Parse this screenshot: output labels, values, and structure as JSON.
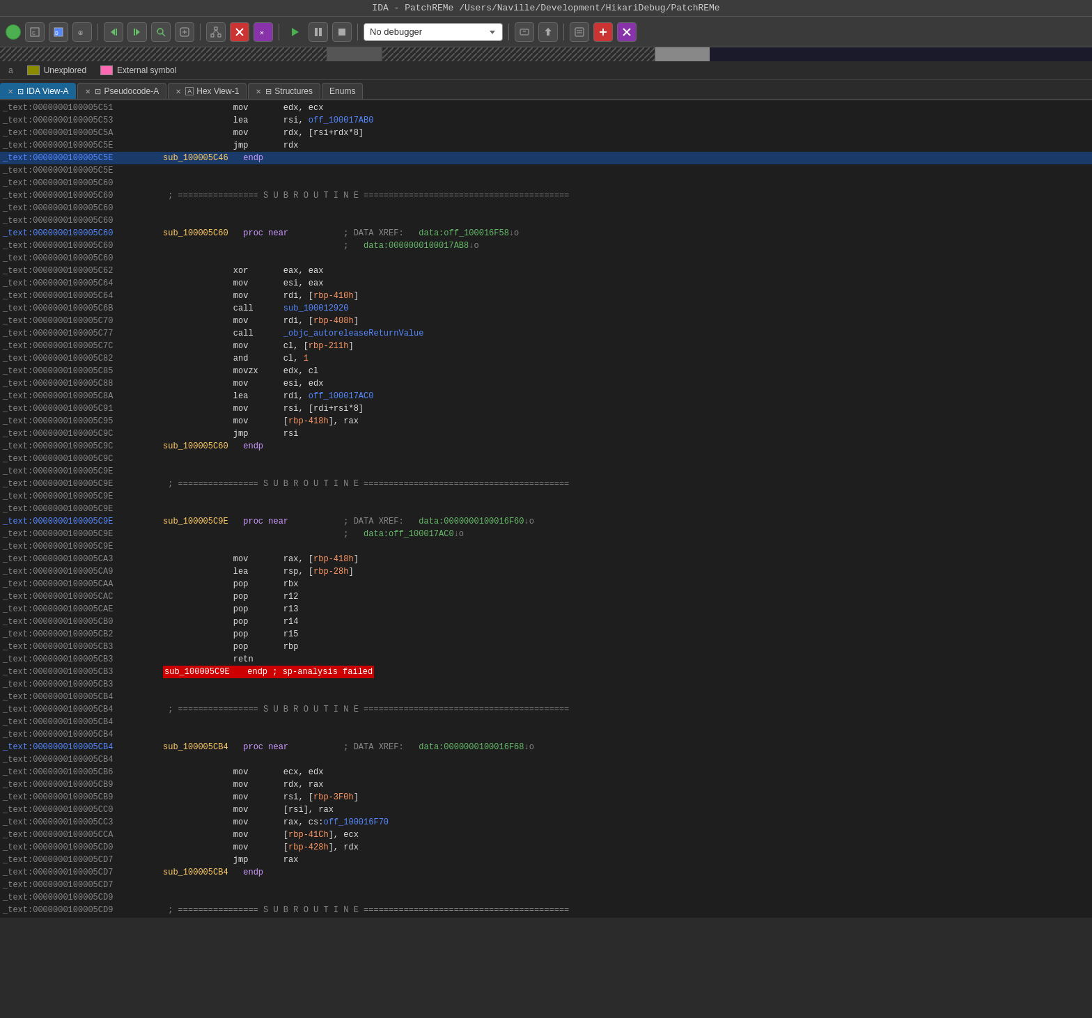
{
  "titleBar": {
    "text": "IDA - PatchREMe /Users/Naville/Development/HikariDebug/PatchREMe"
  },
  "toolbar": {
    "debuggerLabel": "No debugger"
  },
  "legend": {
    "items": [
      {
        "label": "Unexplored",
        "color": "#8B8B00"
      },
      {
        "label": "External symbol",
        "color": "#ff69b4"
      }
    ]
  },
  "tabs": [
    {
      "id": "ida-view",
      "label": "IDA View-A",
      "active": true,
      "closeable": true
    },
    {
      "id": "pseudocode",
      "label": "Pseudocode-A",
      "active": false,
      "closeable": true
    },
    {
      "id": "hex-view",
      "label": "Hex View-1",
      "active": false,
      "closeable": true
    },
    {
      "id": "structures",
      "label": "Structures",
      "active": false,
      "closeable": true
    },
    {
      "id": "enums",
      "label": "Enums",
      "active": false,
      "closeable": false
    }
  ],
  "codeLines": [
    {
      "addr": "_text:0000000100005C51",
      "code": "              mov       edx, ecx"
    },
    {
      "addr": "_text:0000000100005C53",
      "code": "              lea       rsi, off_100017AB0"
    },
    {
      "addr": "_text:0000000100005C5A",
      "code": "              mov       rdx, [rsi+rdx*8]"
    },
    {
      "addr": "_text:0000000100005C5E",
      "code": "              jmp       rdx"
    },
    {
      "addr": "_text:0000000100005C5E sub_100005C46",
      "code": "  endp",
      "highlight": "blue-addr"
    },
    {
      "addr": "_text:0000000100005C5E",
      "code": ""
    },
    {
      "addr": "_text:0000000100005C60",
      "code": ""
    },
    {
      "addr": "_text:0000000100005C60",
      "code": "; ================ S U B R O U T I N E ========================================="
    },
    {
      "addr": "_text:0000000100005C60",
      "code": ""
    },
    {
      "addr": "_text:0000000100005C60",
      "code": ""
    },
    {
      "addr": "_text:0000000100005C60 sub_100005C60",
      "code": "  proc near           ; DATA XREF:   data:off_100016F58↓o"
    },
    {
      "addr": "_text:0000000100005C60",
      "code": "                                    ;   data:0000000100017AB8↓o"
    },
    {
      "addr": "_text:0000000100005C60",
      "code": ""
    },
    {
      "addr": "_text:0000000100005C62",
      "code": "              xor       eax, eax"
    },
    {
      "addr": "_text:0000000100005C64",
      "code": "              mov       esi, eax"
    },
    {
      "addr": "_text:0000000100005C64",
      "code": "              mov       rdi, [rbp-410h]"
    },
    {
      "addr": "_text:0000000100005C6B",
      "code": "              call      sub_100012920"
    },
    {
      "addr": "_text:0000000100005C70",
      "code": "              mov       rdi, [rbp-408h]"
    },
    {
      "addr": "_text:0000000100005C77",
      "code": "              call      _objc_autoreleaseReturnValue"
    },
    {
      "addr": "_text:0000000100005C7C",
      "code": "              mov       cl, [rbp-211h]"
    },
    {
      "addr": "_text:0000000100005C82",
      "code": "              and       cl, 1"
    },
    {
      "addr": "_text:0000000100005C85",
      "code": "              movzx     edx, cl"
    },
    {
      "addr": "_text:0000000100005C88",
      "code": "              mov       esi, edx"
    },
    {
      "addr": "_text:0000000100005C8A",
      "code": "              lea       rdi, off_100017AC0"
    },
    {
      "addr": "_text:0000000100005C91",
      "code": "              mov       rsi, [rdi+rsi*8]"
    },
    {
      "addr": "_text:0000000100005C95",
      "code": "              mov       [rbp-418h], rax"
    },
    {
      "addr": "_text:0000000100005C9C",
      "code": "              jmp       rsi"
    },
    {
      "addr": "_text:0000000100005C9C sub_100005C60",
      "code": "  endp"
    },
    {
      "addr": "_text:0000000100005C9C",
      "code": ""
    },
    {
      "addr": "_text:0000000100005C9E",
      "code": ""
    },
    {
      "addr": "_text:0000000100005C9E",
      "code": "; ================ S U B R O U T I N E ========================================="
    },
    {
      "addr": "_text:0000000100005C9E",
      "code": ""
    },
    {
      "addr": "_text:0000000100005C9E",
      "code": ""
    },
    {
      "addr": "_text:0000000100005C9E sub_100005C9E",
      "code": "  proc near           ; DATA XREF:   data:0000000100016F60↓o"
    },
    {
      "addr": "_text:0000000100005C9E",
      "code": "                                    ;   data:off_100017AC0↓o"
    },
    {
      "addr": "_text:0000000100005C9E",
      "code": ""
    },
    {
      "addr": "_text:0000000100005CA3",
      "code": "              mov       rax, [rbp-418h]"
    },
    {
      "addr": "_text:0000000100005CA9",
      "code": "              lea       rsp, [rbp-28h]"
    },
    {
      "addr": "_text:0000000100005CAA",
      "code": "              pop       rbx"
    },
    {
      "addr": "_text:0000000100005CAC",
      "code": "              pop       r12"
    },
    {
      "addr": "_text:0000000100005CAE",
      "code": "              pop       r13"
    },
    {
      "addr": "_text:0000000100005CB0",
      "code": "              pop       r14"
    },
    {
      "addr": "_text:0000000100005CB2",
      "code": "              pop       r15"
    },
    {
      "addr": "_text:0000000100005CB3",
      "code": "              pop       rbp"
    },
    {
      "addr": "_text:0000000100005CB3",
      "code": "              retn"
    },
    {
      "addr": "_text:0000000100005CB3 sub_100005C9E",
      "code": "  endp ; sp-analysis failed",
      "highlight": "red"
    },
    {
      "addr": "_text:0000000100005CB3",
      "code": ""
    },
    {
      "addr": "_text:0000000100005CB4",
      "code": ""
    },
    {
      "addr": "_text:0000000100005CB4",
      "code": "; ================ S U B R O U T I N E ========================================="
    },
    {
      "addr": "_text:0000000100005CB4",
      "code": ""
    },
    {
      "addr": "_text:0000000100005CB4",
      "code": ""
    },
    {
      "addr": "_text:0000000100005CB4 sub_100005CB4",
      "code": "  proc near           ; DATA XREF:   data:0000000100016F68↓o"
    },
    {
      "addr": "_text:0000000100005CB4",
      "code": ""
    },
    {
      "addr": "_text:0000000100005CB6",
      "code": "              mov       ecx, edx"
    },
    {
      "addr": "_text:0000000100005CB9",
      "code": "              mov       rdx, rax"
    },
    {
      "addr": "_text:0000000100005CB9",
      "code": "              mov       rsi, [rbp-3F0h]"
    },
    {
      "addr": "_text:0000000100005CC0",
      "code": "              mov       [rsi], rax"
    },
    {
      "addr": "_text:0000000100005CC3",
      "code": "              mov       rax, cs:off_100016F70"
    },
    {
      "addr": "_text:0000000100005CCA",
      "code": "              mov       [rbp-41Ch], ecx"
    },
    {
      "addr": "_text:0000000100005CD0",
      "code": "              mov       [rbp-428h], rdx"
    },
    {
      "addr": "_text:0000000100005CD7",
      "code": "              jmp       rax"
    },
    {
      "addr": "_text:0000000100005CD7 sub_100005CB4",
      "code": "  endp"
    },
    {
      "addr": "_text:0000000100005CD7",
      "code": ""
    },
    {
      "addr": "_text:0000000100005CD9",
      "code": ""
    },
    {
      "addr": "_text:0000000100005CD9",
      "code": "; ================ S U B R O U T I N E ========================================="
    }
  ]
}
